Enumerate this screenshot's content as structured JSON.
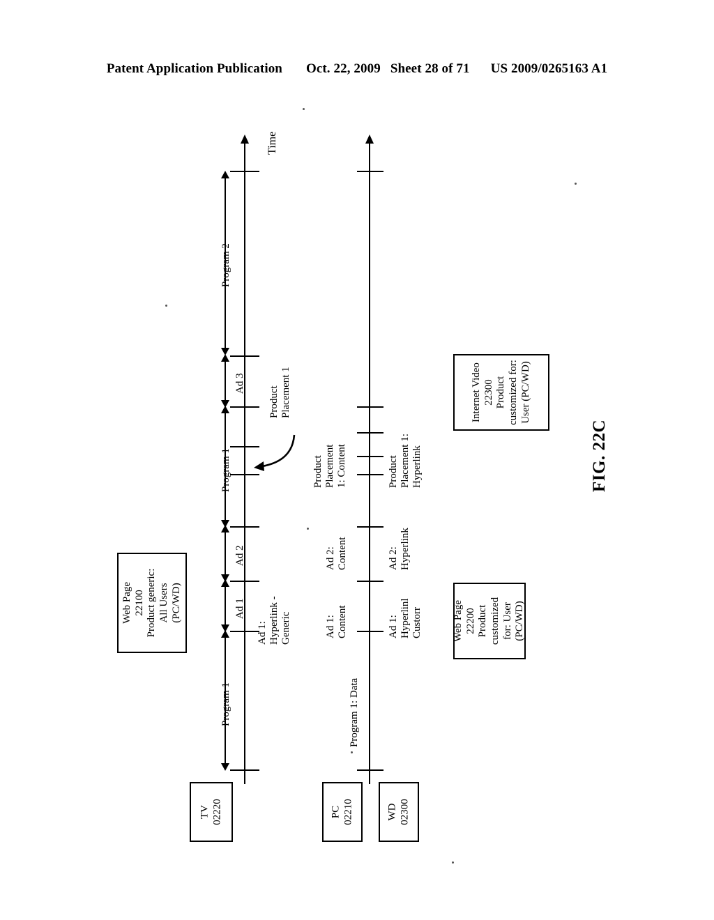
{
  "header": {
    "publication": "Patent Application Publication",
    "date": "Oct. 22, 2009",
    "sheet": "Sheet 28 of 71",
    "number": "US 2009/0265163 A1"
  },
  "figure": {
    "label": "FIG. 22C",
    "time_axis_label": "Time"
  },
  "devices": [
    {
      "id": "tv",
      "name": "TV",
      "number": "02220"
    },
    {
      "id": "pc",
      "name": "PC",
      "number": "02210"
    },
    {
      "id": "wd",
      "name": "WD",
      "number": "02300"
    }
  ],
  "tv_timeline": {
    "segments": [
      {
        "label": "Program 1",
        "kind": "span"
      },
      {
        "label": "Ad 1",
        "kind": "span"
      },
      {
        "label": "Ad 2",
        "kind": "span"
      },
      {
        "label": "Program 1",
        "kind": "span"
      },
      {
        "label": "Ad 3",
        "kind": "span"
      },
      {
        "label": "Program 2",
        "kind": "span"
      }
    ],
    "annotations": [
      {
        "label": "Ad 1:\nHyperlink -\nGeneric"
      },
      {
        "label": "Product\nPlacement 1"
      }
    ]
  },
  "pc_timeline": {
    "annotations": [
      {
        "label": "Program 1: Data"
      },
      {
        "label": "Ad 1:\nContent"
      },
      {
        "label": "Ad 2:\nContent"
      },
      {
        "label": "Product\nPlacement\n1: Content"
      }
    ]
  },
  "wd_timeline": {
    "annotations": [
      {
        "label": "Ad 1:\nHyperlinl\nCustorr"
      },
      {
        "label": "Ad 2:\nHyperlink"
      },
      {
        "label": "Product\nPlacement 1:\nHyperlink"
      }
    ]
  },
  "callout_boxes": [
    {
      "id": "web-page-22100",
      "title": "Web Page",
      "number": "22100",
      "line3": "Product generic:",
      "line4": "All Users",
      "line5": "(PC/WD)"
    },
    {
      "id": "web-page-22200",
      "title": "Web Page",
      "number": "22200",
      "line3": "Product",
      "line4": "customized",
      "line5": "for: User",
      "line6": "(PC/WD)"
    },
    {
      "id": "internet-video-22300",
      "title": "Internet Video",
      "number": "22300",
      "line3": "Product",
      "line4": "customized for:",
      "line5": "User (PC/WD)"
    }
  ]
}
